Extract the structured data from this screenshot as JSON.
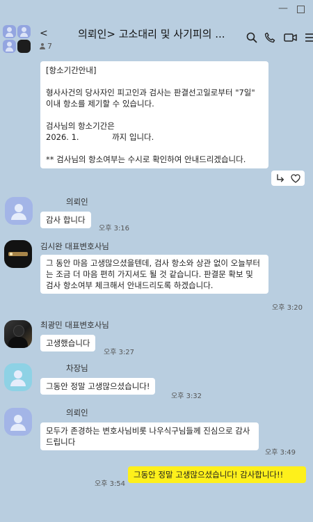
{
  "window": {
    "minimize": "—"
  },
  "header": {
    "back": "<",
    "title": "의뢰인> 고소대리 및 사기피의 ...",
    "member_count": "7",
    "icons": [
      "search-icon",
      "phone-icon",
      "video-icon",
      "menu-icon"
    ]
  },
  "messages": [
    {
      "text": "[항소기간안내]\n\n형사사건의 당사자인 피고인과 검사는 판결선고일로부터 \"7일\" 이내 항소를 제기할 수 있습니다.\n\n검사님의 항소기간은\n2026. 1.             까지 입니다.\n\n** 검사님의 항소여부는 수시로 확인하여 안내드리겠습니다."
    },
    {
      "sender": "의뢰인",
      "text": "감사 합니다",
      "time": "오후 3:16"
    },
    {
      "sender": "김시완 대표변호사님",
      "text": "그 동안 마음 고생많으셨을텐데, 검사 항소와 상관 없이 오늘부터는 조금 더 마음 편히 가지셔도 될 것 같습니다. 판결문 확보 및 검사 항소여부 체크해서 안내드리도록 하겠습니다.",
      "time": "오후 3:20"
    },
    {
      "sender": "최광민 대표변호사님",
      "text": "고생했습니다",
      "time": "오후 3:27"
    },
    {
      "sender": "차장님",
      "text": "그동안 정말 고생많으셨습니다!",
      "time": "오후 3:32"
    },
    {
      "sender": "의뢰인",
      "text": "모두가 존경하는 변호사님비롯 나우식구님들께 진심으로 감사드립니다",
      "time": "오후 3:49"
    },
    {
      "text": "그동안 정말 고생많으셨습니다! 감사합니다!!",
      "time": "오후 3:54",
      "mine": true
    }
  ],
  "colors": {
    "background": "#b9cee0",
    "my_bubble": "#fef01b",
    "bubble": "#ffffff"
  }
}
